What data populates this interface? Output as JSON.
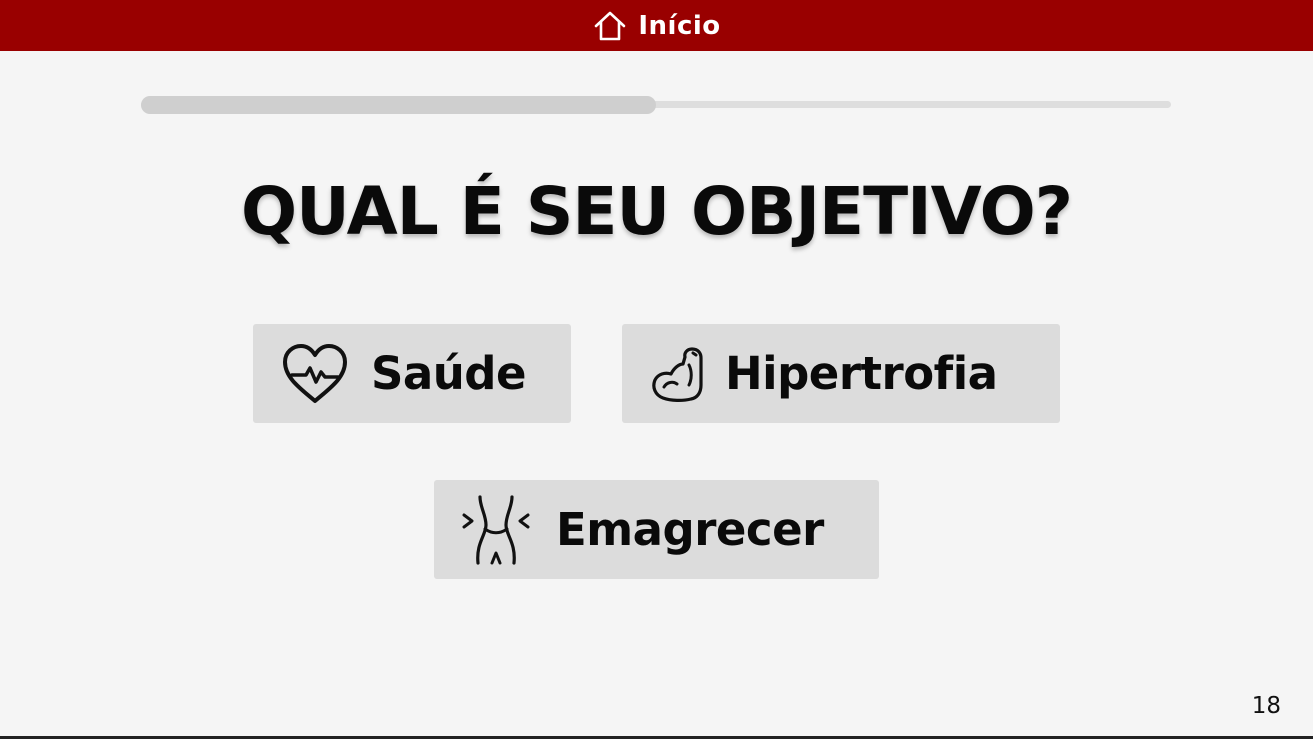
{
  "header": {
    "title": "Início",
    "icon": "home-icon",
    "background": "#990000"
  },
  "progress": {
    "value": 0.5
  },
  "question": {
    "text": "QUAL É SEU OBJETIVO?"
  },
  "options": [
    {
      "label": "Saúde",
      "icon": "heart-pulse-icon"
    },
    {
      "label": "Hipertrofia",
      "icon": "flexed-biceps-icon"
    },
    {
      "label": "Emagrecer",
      "icon": "waist-icon"
    }
  ],
  "page_number": "18"
}
